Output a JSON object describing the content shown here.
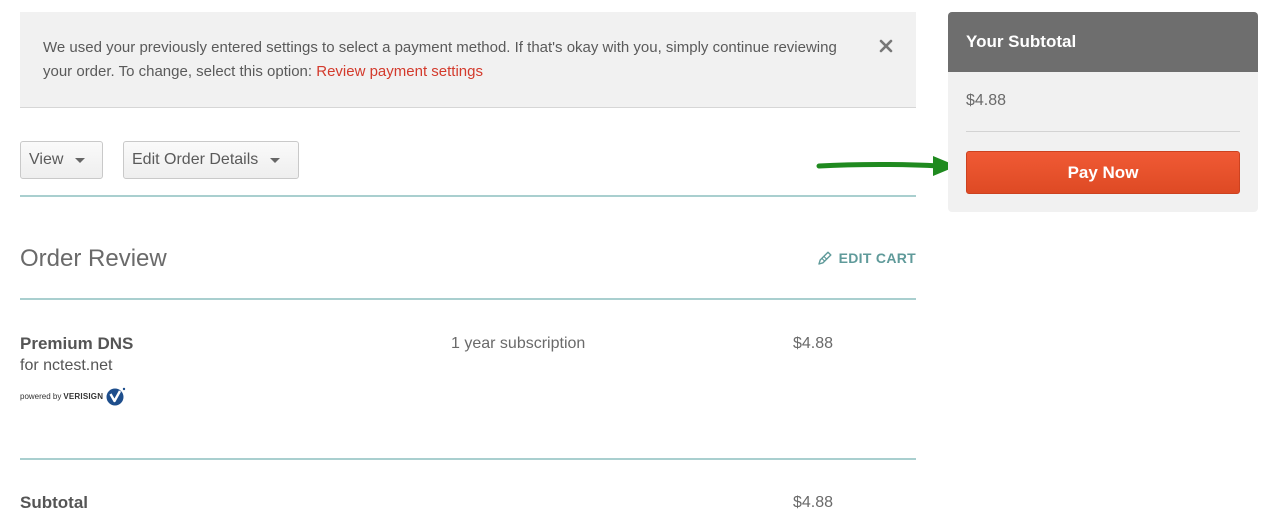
{
  "notice": {
    "text": "We used your previously entered settings to select a payment method. If that's okay with you, simply continue reviewing your order. To change, select this option: ",
    "link": "Review payment settings",
    "close_icon": "close-icon"
  },
  "toolbar": {
    "view_label": "View",
    "edit_label": "Edit Order Details"
  },
  "order_review": {
    "title": "Order Review",
    "edit_cart_label": "EDIT CART",
    "edit_cart_icon": "pencil-icon",
    "items": [
      {
        "name": "Premium DNS",
        "domain": "for nctest.net",
        "powered_by": "powered by",
        "provider": "VERISIGN",
        "term": "1 year subscription",
        "price": "$4.88"
      }
    ],
    "subtotal_label": "Subtotal",
    "subtotal_value": "$4.88"
  },
  "sidebar": {
    "header": "Your Subtotal",
    "amount": "$4.88",
    "pay_label": "Pay Now"
  },
  "colors": {
    "accent_red": "#e2502b",
    "link_red": "#d33a2c",
    "teal_rule": "#a9cfcf",
    "edit_cart_teal": "#5f9a9a",
    "arrow_green": "#1f8a1f"
  }
}
